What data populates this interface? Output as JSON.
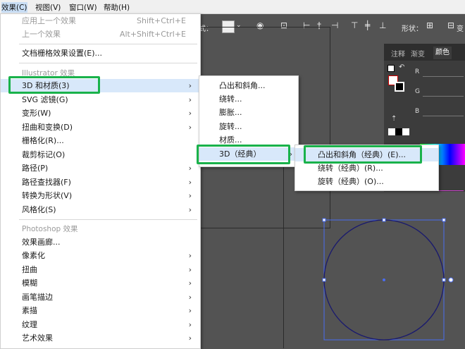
{
  "menubar": {
    "items": [
      "效果(C)",
      "视图(V)",
      "窗口(W)",
      "帮助(H)"
    ]
  },
  "control_bar": {
    "style_label": "样式：",
    "shape_label": "形状：",
    "transform_label": "变"
  },
  "panel": {
    "tabs": [
      "注释",
      "渐变",
      "颜色"
    ],
    "channels": [
      "R",
      "G",
      "B"
    ]
  },
  "effect_menu": {
    "items_top": [
      {
        "label": "应用上一个效果",
        "shortcut": "Shift+Ctrl+E"
      },
      {
        "label": "上一个效果",
        "shortcut": "Alt+Shift+Ctrl+E"
      }
    ],
    "doc_raster": "文档栅格效果设置(E)...",
    "illustrator_header": "Illustrator 效果",
    "illustrator_items": [
      "3D 和材质(3)",
      "SVG 滤镜(G)",
      "变形(W)",
      "扭曲和变换(D)",
      "栅格化(R)...",
      "裁剪标记(O)",
      "路径(P)",
      "路径查找器(F)",
      "转换为形状(V)",
      "风格化(S)"
    ],
    "photoshop_header": "Photoshop 效果",
    "photoshop_items": [
      "效果画廊...",
      "像素化",
      "扭曲",
      "模糊",
      "画笔描边",
      "素描",
      "纹理",
      "艺术效果"
    ]
  },
  "submenu_3d": {
    "items": [
      "凸出和斜角...",
      "绕转...",
      "膨胀...",
      "旋转...",
      "材质...",
      "3D（经典）"
    ]
  },
  "submenu_classic": {
    "items": [
      "凸出和斜角（经典）(E)...",
      "绕转（经典）(R)...",
      "旋转（经典）(O)..."
    ]
  },
  "colors": {
    "highlight_green": "#19b24b",
    "selection_blue": "#4a6cf0"
  }
}
